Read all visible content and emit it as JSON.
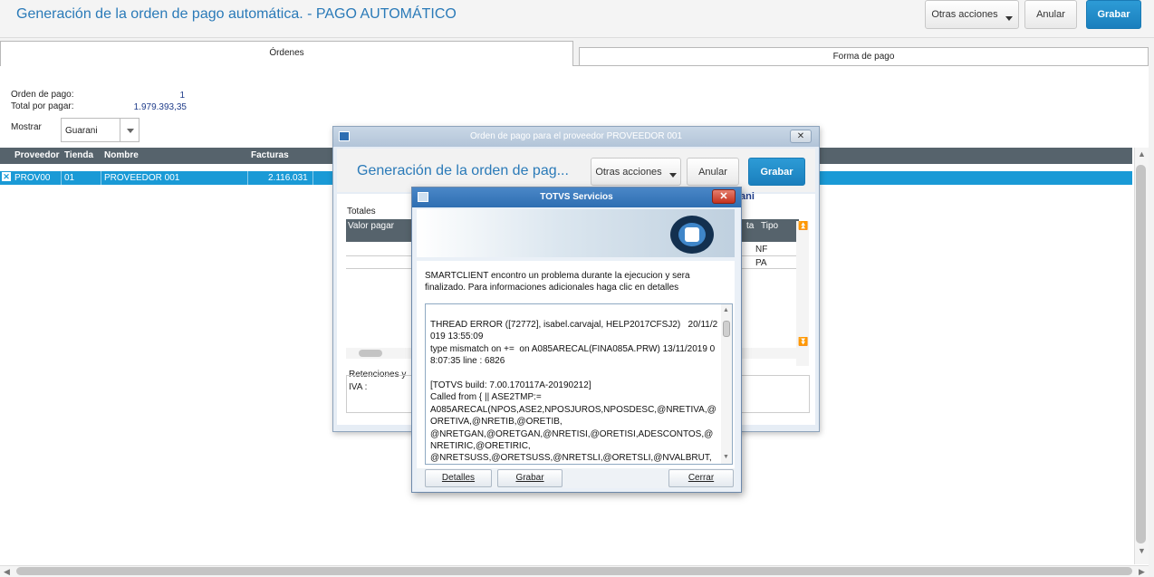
{
  "header": {
    "title": "Generación de la orden de pago automática. - PAGO AUTOMÁTICO",
    "more_actions": "Otras acciones",
    "cancel": "Anular",
    "save": "Grabar"
  },
  "tabs": [
    {
      "label": "Órdenes"
    },
    {
      "label": "Forma de pago"
    }
  ],
  "summary": {
    "order_label": "Orden de pago:",
    "order_value": "1",
    "total_label": "Total por pagar:",
    "total_value": "1.979.393,35",
    "show_label": "Mostrar",
    "currency_selected": "Guarani"
  },
  "grid": {
    "columns": [
      "Proveedor",
      "Tienda",
      "Nombre",
      "Facturas"
    ],
    "rows": [
      {
        "proveedor": "PROV00",
        "tienda": "01",
        "nombre": "PROVEEDOR 001",
        "facturas": "2.116.031"
      }
    ]
  },
  "mid_window": {
    "titlebar": "Orden de pago para el proveedor PROVEEDOR 001",
    "title": "Generación de la orden de pag...",
    "more_actions": "Otras acciones",
    "cancel": "Anular",
    "save": "Grabar",
    "partial_text": "ani",
    "totals_label": "Totales",
    "value_col": "Valor pagar",
    "col_ta": "ta",
    "col_tipo": "Tipo",
    "rows_tipo": [
      "NF",
      "PA"
    ],
    "retenciones": "Retenciones y",
    "iva": "IVA :"
  },
  "dialog": {
    "title": "TOTVS Servicios",
    "message": "SMARTCLIENT encontro un problema durante la ejecucion y sera finalizado. Para informaciones adicionales haga clic en detalles",
    "detail": "THREAD ERROR ([72772], isabel.carvajal, HELP2017CFSJ2)   20/11/2019 13:55:09\ntype mismatch on +=  on A085ARECAL(FINA085A.PRW) 13/11/2019 08:07:35 line : 6826\n\n[TOTVS build: 7.00.170117A-20190212]\nCalled from { || ASE2TMP:=\nA085ARECAL(NPOS,ASE2,NPOSJUROS,NPOSDESC,@NRETIVA,@ORETIVA,@NRETIB,@ORETIB,\n@NRETGAN,@ORETGAN,@NRETISI,@ORETISI,ADESCONTOS,@NRETIRIC,@ORETIRIC,\n@NRETSUSS,@ORETSUSS,@NRETSLI,@ORETSLI,@NVALBRUT,@OVALBRUT",
    "btn_details": "Detalles",
    "btn_save": "Grabar",
    "btn_close": "Cerrar"
  },
  "colors": {
    "accent": "#2a7ab8",
    "primary_button": "#1a8ccf",
    "selected_row": "#1a9ad6",
    "grid_header": "#56636c"
  },
  "icons": {
    "window": "window-icon",
    "close": "close-icon",
    "logo": "totvs-logo-icon",
    "dropdown": "chevron-down-icon"
  }
}
